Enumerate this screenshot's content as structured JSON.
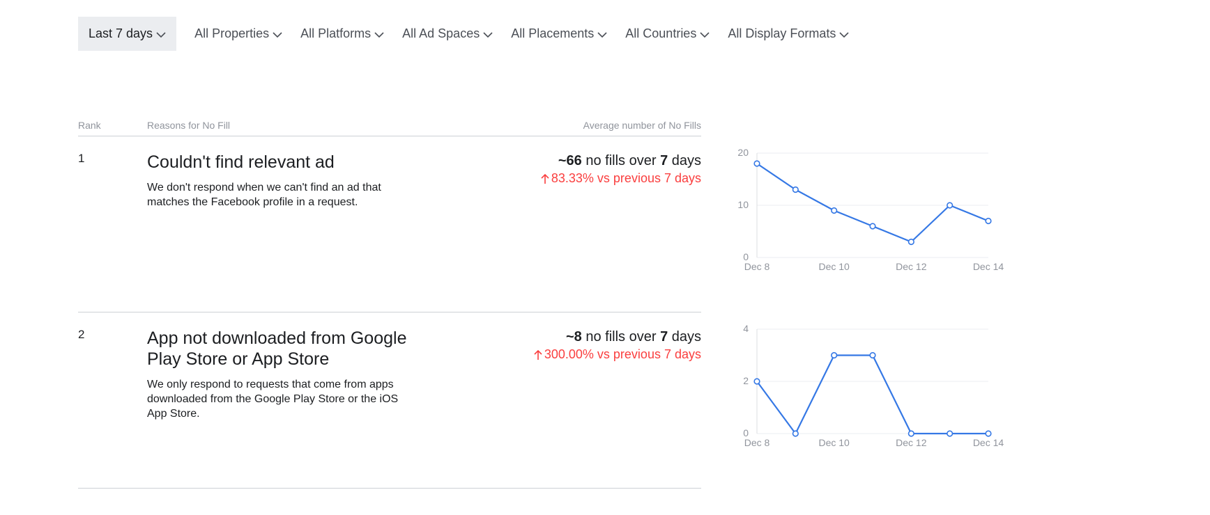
{
  "filters": [
    {
      "label": "Last 7 days",
      "active": true
    },
    {
      "label": "All Properties",
      "active": false
    },
    {
      "label": "All Platforms",
      "active": false
    },
    {
      "label": "All Ad Spaces",
      "active": false
    },
    {
      "label": "All Placements",
      "active": false
    },
    {
      "label": "All Countries",
      "active": false
    },
    {
      "label": "All Display Formats",
      "active": false
    }
  ],
  "table": {
    "headers": {
      "rank": "Rank",
      "reason": "Reasons for No Fill",
      "average": "Average number of No Fills"
    },
    "rows": [
      {
        "rank": "1",
        "title": "Couldn't find relevant ad",
        "description": "We don't respond when we can't find an ad that matches the Facebook profile in a request.",
        "count": "~66",
        "count_mid": " no fills over ",
        "days": "7",
        "count_suffix": " days",
        "change": "83.33% vs previous 7 days"
      },
      {
        "rank": "2",
        "title": "App not downloaded from Google Play Store or App Store",
        "description": "We only respond to requests that come from apps downloaded from the Google Play Store or the iOS App Store.",
        "count": "~8",
        "count_mid": " no fills over ",
        "days": "7",
        "count_suffix": " days",
        "change": "300.00% vs previous 7 days"
      }
    ]
  },
  "colors": {
    "line": "#3578e5",
    "increase": "#fa3e3e"
  },
  "chart_data": [
    {
      "type": "line",
      "x": [
        "Dec 8",
        "Dec 9",
        "Dec 10",
        "Dec 11",
        "Dec 12",
        "Dec 13",
        "Dec 14"
      ],
      "x_tick_labels": [
        "Dec 8",
        "Dec 10",
        "Dec 12",
        "Dec 14"
      ],
      "y_ticks": [
        "0",
        "10",
        "20"
      ],
      "ylim": [
        0,
        20
      ],
      "grid": true,
      "series": [
        {
          "values": [
            18,
            13,
            9,
            6,
            3,
            10,
            7
          ]
        }
      ]
    },
    {
      "type": "line",
      "x": [
        "Dec 8",
        "Dec 9",
        "Dec 10",
        "Dec 11",
        "Dec 12",
        "Dec 13",
        "Dec 14"
      ],
      "x_tick_labels": [
        "Dec 8",
        "Dec 10",
        "Dec 12",
        "Dec 14"
      ],
      "y_ticks": [
        "0",
        "2",
        "4"
      ],
      "ylim": [
        0,
        4
      ],
      "grid": true,
      "series": [
        {
          "values": [
            2,
            0,
            3,
            3,
            0,
            0,
            0
          ]
        }
      ]
    }
  ]
}
